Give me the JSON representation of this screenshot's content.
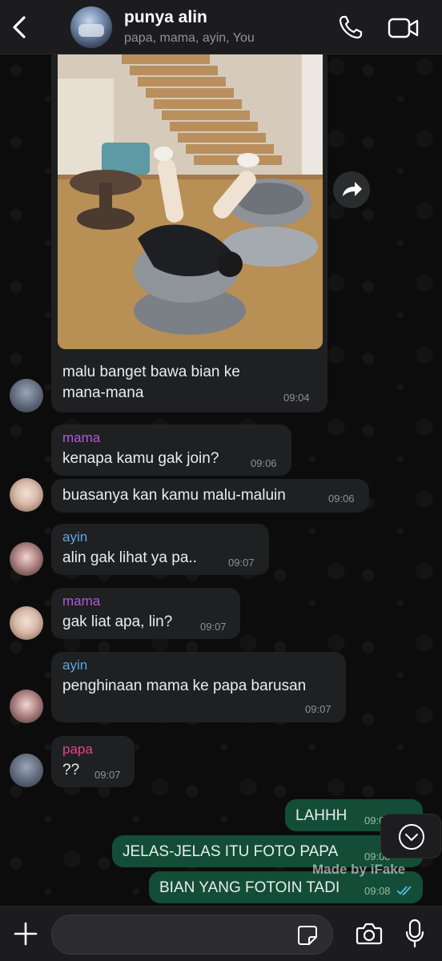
{
  "header": {
    "title": "punya alin",
    "subtitle": "papa, mama, ayin, You"
  },
  "icons": {
    "back": "chevron-left-icon",
    "call": "phone-icon",
    "video": "video-camera-icon",
    "forward": "forward-arrow-icon",
    "scroll_down": "chevron-down-icon",
    "plus": "plus-icon",
    "sticker": "sticker-icon",
    "camera": "camera-icon",
    "mic": "microphone-icon"
  },
  "colors": {
    "incoming_bubble": "#1f2021",
    "outgoing_bubble": "#134d37",
    "sender_mama": "#b15ad6",
    "sender_ayin": "#5ba8e8",
    "sender_papa": "#e0468f",
    "read_ticks": "#53bdeb"
  },
  "messages": [
    {
      "sender": "",
      "text": "malu banget bawa bian ke",
      "text2": "mana-mana",
      "time": "09:04"
    },
    {
      "sender": "mama",
      "text": "kenapa kamu gak join?",
      "time": "09:06"
    },
    {
      "sender": "",
      "text": "buasanya kan kamu malu-maluin",
      "time": "09:06"
    },
    {
      "sender": "ayin",
      "text": "alin gak lihat ya pa..",
      "time": "09:07"
    },
    {
      "sender": "mama",
      "text": "gak liat apa, lin?",
      "time": "09:07"
    },
    {
      "sender": "ayin",
      "text": "penghinaan mama ke papa barusan",
      "time": "09:07"
    },
    {
      "sender": "papa",
      "text": "??",
      "time": "09:07"
    },
    {
      "sender": "You",
      "text": "LAHHH",
      "time": "09:08"
    },
    {
      "sender": "You",
      "text": "JELAS-JELAS ITU FOTO PAPA",
      "time": "09:08"
    },
    {
      "sender": "You",
      "text": "BIAN YANG FOTOIN TADI",
      "time": "09:08"
    }
  ],
  "watermark": "Made by iFake",
  "composer": {
    "placeholder": ""
  }
}
